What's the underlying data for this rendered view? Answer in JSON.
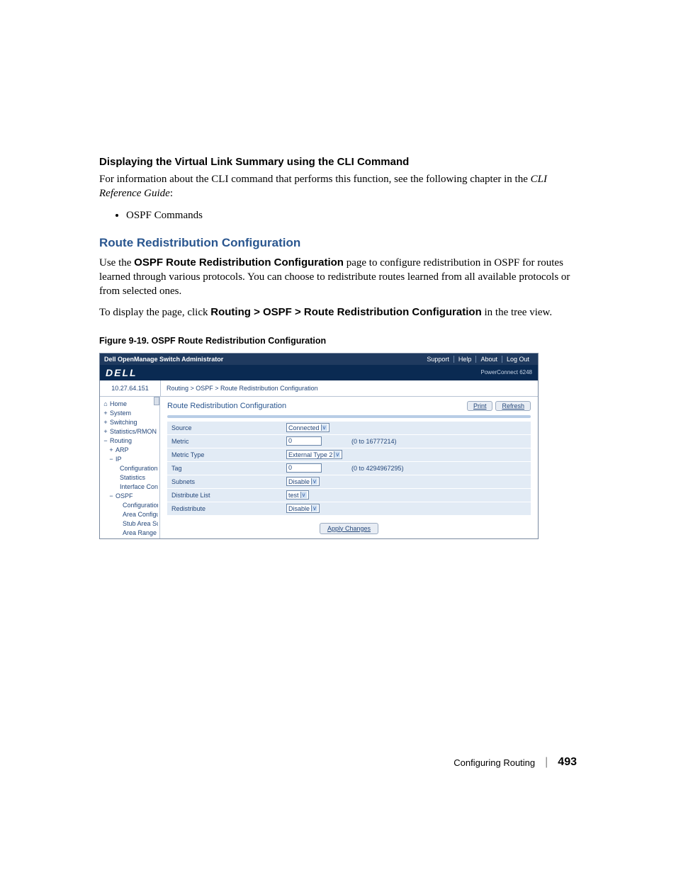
{
  "doc": {
    "heading_cli": "Displaying the Virtual Link Summary using the CLI Command",
    "para_cli_1": "For information about the CLI command that performs this function, see the following chapter in the ",
    "para_cli_ref": "CLI Reference Guide",
    "para_cli_colon": ":",
    "bullet1": "OSPF Commands",
    "heading_route": "Route Redistribution Configuration",
    "para_route_1a": "Use the ",
    "para_route_1b": "OSPF Route Redistribution Configuration",
    "para_route_1c": " page to configure redistribution in OSPF for routes learned through various protocols. You can choose to redistribute routes learned from all available protocols or from selected ones.",
    "para_route_2a": "To display the page, click ",
    "para_route_2b": "Routing > OSPF > Route Redistribution Configuration",
    "para_route_2c": " in the tree view.",
    "fig_cap": "Figure 9-19.    OSPF Route Redistribution Configuration"
  },
  "shot": {
    "topbar_title": "Dell OpenManage Switch Administrator",
    "nav": {
      "support": "Support",
      "help": "Help",
      "about": "About",
      "logout": "Log Out"
    },
    "brand": "DELL",
    "device": "PowerConnect 6248",
    "ip": "10.27.64.151",
    "crumb": "Routing > OSPF > Route Redistribution Configuration",
    "page_title": "Route Redistribution Configuration",
    "btn_print": "Print",
    "btn_refresh": "Refresh",
    "tree": {
      "home": "Home",
      "system": "System",
      "switching": "Switching",
      "stats": "Statistics/RMON",
      "routing": "Routing",
      "arp": "ARP",
      "ip": "IP",
      "ip_config": "Configuration",
      "ip_stats": "Statistics",
      "ip_if": "Interface Config",
      "ospf": "OSPF",
      "ospf_config": "Configuration",
      "ospf_area": "Area Configurati",
      "ospf_stub": "Stub Area Summ",
      "ospf_range": "Area Range Con"
    },
    "rows": [
      {
        "label": "Source",
        "type": "select",
        "value": "Connected",
        "hint": ""
      },
      {
        "label": "Metric",
        "type": "input",
        "value": "0",
        "hint": "(0 to 16777214)"
      },
      {
        "label": "Metric Type",
        "type": "select",
        "value": "External Type 2",
        "hint": ""
      },
      {
        "label": "Tag",
        "type": "input",
        "value": "0",
        "hint": "(0 to 4294967295)"
      },
      {
        "label": "Subnets",
        "type": "select",
        "value": "Disable",
        "hint": ""
      },
      {
        "label": "Distribute List",
        "type": "select",
        "value": "test",
        "hint": ""
      },
      {
        "label": "Redistribute",
        "type": "select",
        "value": "Disable",
        "hint": ""
      }
    ],
    "apply": "Apply Changes"
  },
  "footer": {
    "section": "Configuring Routing",
    "page": "493"
  }
}
